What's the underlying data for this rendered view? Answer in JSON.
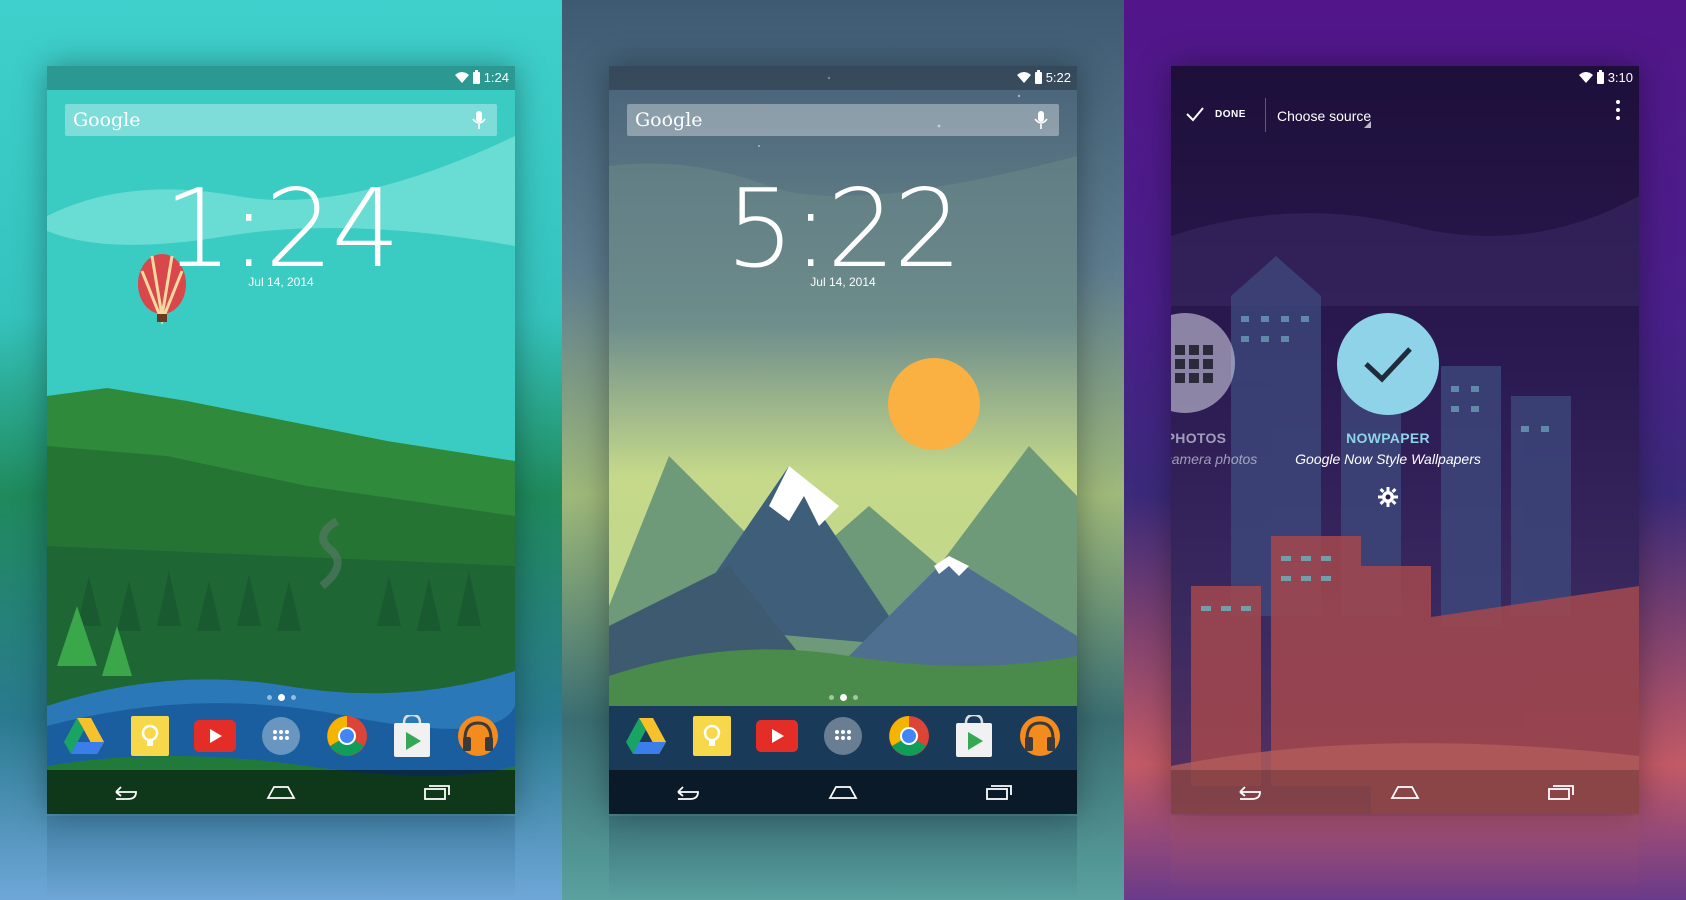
{
  "screens": [
    {
      "status": {
        "time": "1:24"
      },
      "search": {
        "label": "Google"
      },
      "clock": {
        "time": "1:24",
        "date": "Jul 14, 2014"
      },
      "dock": [
        "drive-icon",
        "keep-icon",
        "youtube-icon",
        "app-drawer-icon",
        "chrome-icon",
        "play-store-icon",
        "play-music-icon"
      ]
    },
    {
      "status": {
        "time": "5:22"
      },
      "search": {
        "label": "Google"
      },
      "clock": {
        "time": "5:22",
        "date": "Jul 14, 2014"
      },
      "dock": [
        "drive-icon",
        "keep-icon",
        "youtube-icon",
        "app-drawer-icon",
        "chrome-icon",
        "play-store-icon",
        "play-music-icon"
      ]
    },
    {
      "status": {
        "time": "3:10"
      },
      "actionbar": {
        "done": "DONE",
        "source": "Choose source"
      },
      "sources": [
        {
          "title": "PHOTOS",
          "subtitle": "camera photos",
          "icon": "grid-icon"
        },
        {
          "title": "NOWPAPER",
          "subtitle": "Google Now Style Wallpapers",
          "icon": "check-icon",
          "selected": true
        }
      ]
    }
  ],
  "colors": {
    "accent": "#8fd3e8",
    "bg_left": "#3fd0cc",
    "bg_mid": "#5d7c8e",
    "bg_right": "#52168a"
  }
}
